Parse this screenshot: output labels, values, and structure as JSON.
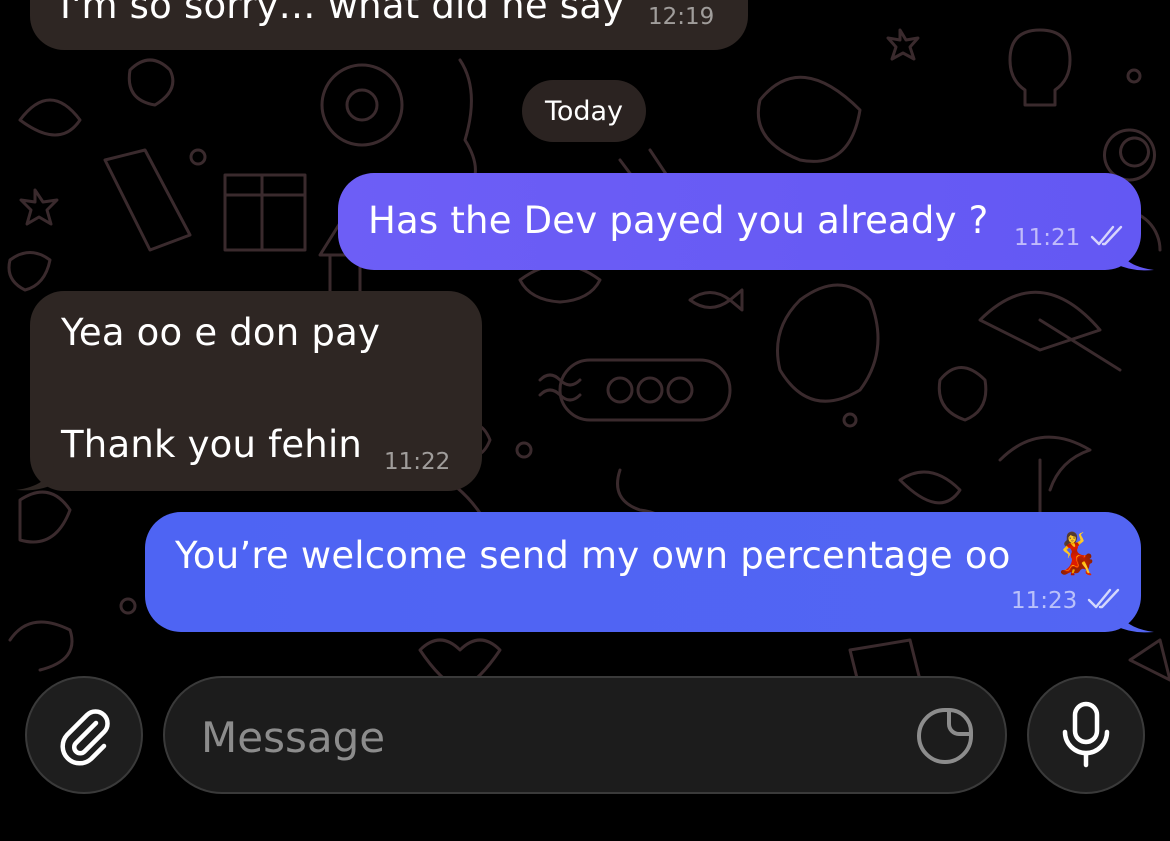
{
  "chat": {
    "prev_message": {
      "text": "I'm so sorry… what did he say",
      "time": "12:19"
    },
    "date_divider": "Today",
    "messages": [
      {
        "direction": "out",
        "text": "Has the Dev payed you already ?",
        "time": "11:21",
        "status": "read"
      },
      {
        "direction": "in",
        "line1": "Yea oo e don pay",
        "line2": "Thank you fehin",
        "time": "11:22"
      },
      {
        "direction": "out",
        "text": "You’re welcome send my own percentage oo",
        "emoji": "💃",
        "time": "11:23",
        "status": "read"
      }
    ]
  },
  "composer": {
    "placeholder": "Message",
    "value": "",
    "attach_icon": "paperclip-icon",
    "sticker_icon": "sticker-icon",
    "mic_icon": "microphone-icon"
  },
  "colors": {
    "background": "#000000",
    "incoming_bubble": "#2e2623",
    "outgoing_bubble_top": "#6b5cf5",
    "outgoing_bubble_bottom": "#4c62f2",
    "wallpaper_doodles": "#3b2a2f"
  }
}
